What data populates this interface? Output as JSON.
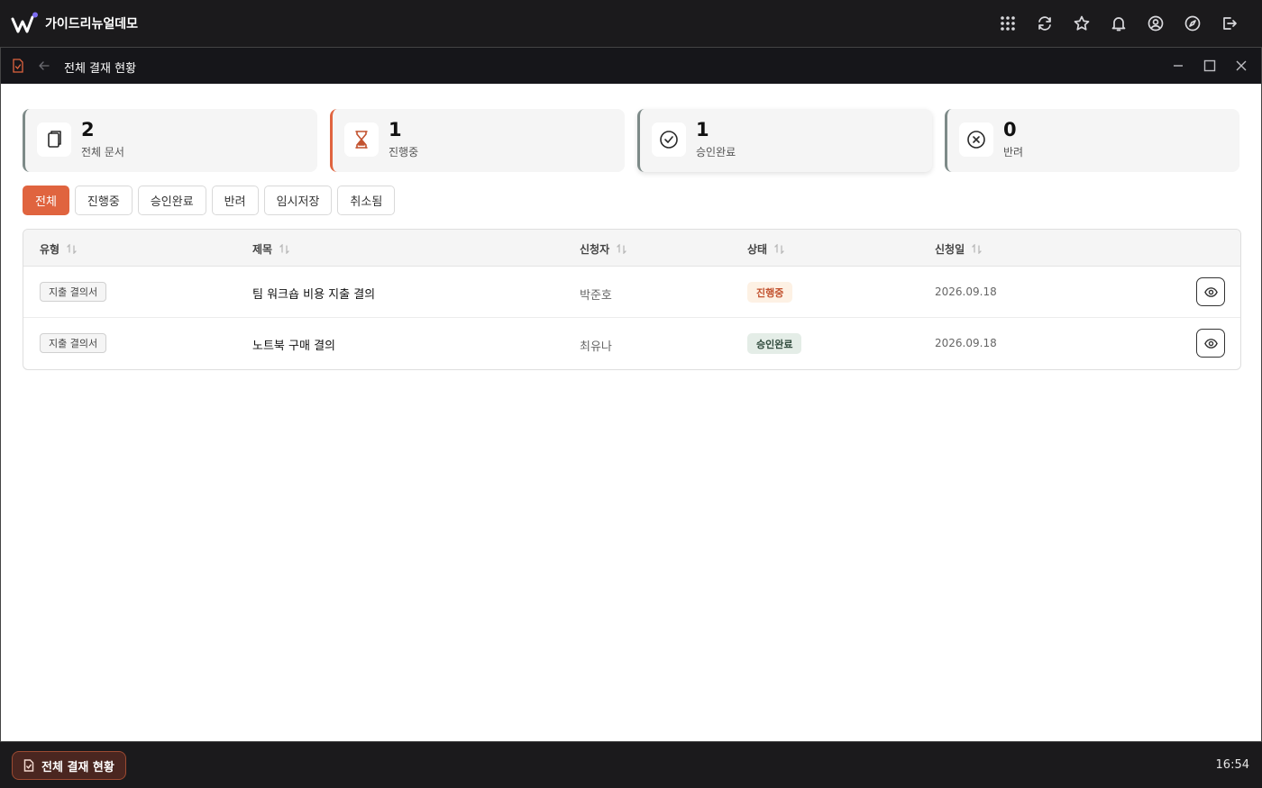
{
  "app": {
    "name": "가이드리뉴얼데모",
    "brand_color": "#7c6cf0"
  },
  "top_icons": [
    "apps-grid-icon",
    "refresh-icon",
    "star-icon",
    "bell-icon",
    "user-circle-icon",
    "compass-icon",
    "logout-icon"
  ],
  "window": {
    "title": "전체 결재 현황",
    "accent": "#e0643f"
  },
  "stats": [
    {
      "value": "2",
      "label": "전체 문서",
      "icon": "documents-icon"
    },
    {
      "value": "1",
      "label": "진행중",
      "icon": "hourglass-icon"
    },
    {
      "value": "1",
      "label": "승인완료",
      "icon": "check-circle-icon"
    },
    {
      "value": "0",
      "label": "반려",
      "icon": "x-circle-icon"
    }
  ],
  "filters": [
    {
      "label": "전체",
      "active": true
    },
    {
      "label": "진행중",
      "active": false
    },
    {
      "label": "승인완료",
      "active": false
    },
    {
      "label": "반려",
      "active": false
    },
    {
      "label": "임시저장",
      "active": false
    },
    {
      "label": "취소됨",
      "active": false
    }
  ],
  "table": {
    "columns": [
      "유형",
      "제목",
      "신청자",
      "상태",
      "신청일"
    ],
    "rows": [
      {
        "type": "지출 결의서",
        "title": "팀 워크숍 비용 지출 결의",
        "applicant": "박준호",
        "status": "진행중",
        "status_color": "#c2522f",
        "status_bg": "#fdf1e4",
        "date": "2026.09.18"
      },
      {
        "type": "지출 결의서",
        "title": "노트북 구매 결의",
        "applicant": "최유나",
        "status": "승인완료",
        "status_color": "#2f4a3c",
        "status_bg": "#e4ede7",
        "date": "2026.09.18"
      }
    ]
  },
  "taskbar": {
    "item_label": "전체 결재 현황",
    "clock": "16:54"
  }
}
